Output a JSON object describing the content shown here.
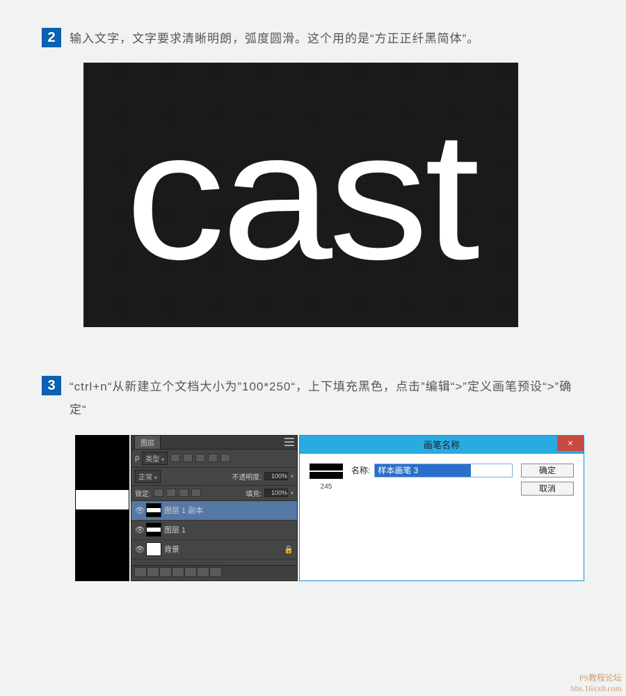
{
  "steps": {
    "s2": {
      "num": "2",
      "text": "输入文字，文字要求清晰明朗，弧度圆滑。这个用的是“方正正纤黑简体”。"
    },
    "s3": {
      "num": "3",
      "text": "“ctrl+n“从新建立个文档大小为”100*250“，上下填充黑色，点击”编辑“>”定义画笔预设“>”确定“"
    }
  },
  "cast_image": {
    "text": "cast"
  },
  "layers_panel": {
    "tab": "图层",
    "kind_label": "类型",
    "blend_mode": "正常",
    "opacity_label": "不透明度:",
    "opacity_value": "100%",
    "lock_label": "锁定:",
    "fill_label": "填充:",
    "fill_value": "100%",
    "layers": [
      {
        "name": "图层 1 副本",
        "visible": true,
        "selected": true
      },
      {
        "name": "图层 1",
        "visible": true,
        "selected": false
      },
      {
        "name": "背景",
        "visible": true,
        "selected": false,
        "locked": true
      }
    ]
  },
  "dialog": {
    "title": "画笔名称",
    "close": "×",
    "name_label": "名称:",
    "name_value": "样本画笔 3",
    "preview_label": "245",
    "ok": "确定",
    "cancel": "取消"
  },
  "watermark": {
    "line1": "PS教程论坛",
    "line2": "bbs.16xx8.com"
  }
}
